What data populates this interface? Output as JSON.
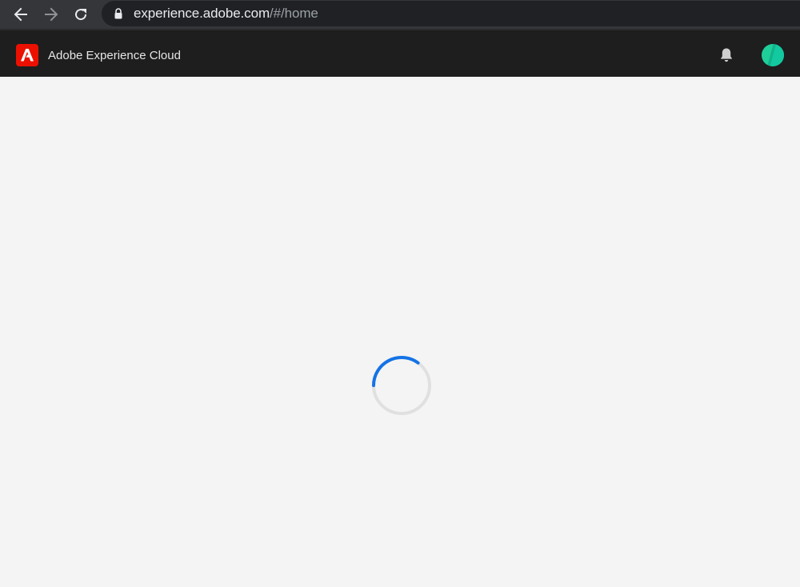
{
  "browser": {
    "url_host": "experience.adobe.com",
    "url_path": "/#/home",
    "icons": {
      "back": "arrow-left-icon",
      "forward": "arrow-right-icon",
      "reload": "reload-icon",
      "lock": "lock-icon"
    }
  },
  "header": {
    "app_title": "Adobe Experience Cloud",
    "icons": {
      "logo": "adobe-logo-icon",
      "notifications": "bell-icon",
      "avatar": "avatar"
    }
  },
  "loading": {
    "icon": "loading-spinner"
  },
  "colors": {
    "adobe_red": "#eb1000",
    "spinner_active": "#1473e6",
    "spinner_track": "#e0e0e0",
    "avatar_green": "#1fcf9a",
    "avatar_teal": "#0fb893"
  }
}
